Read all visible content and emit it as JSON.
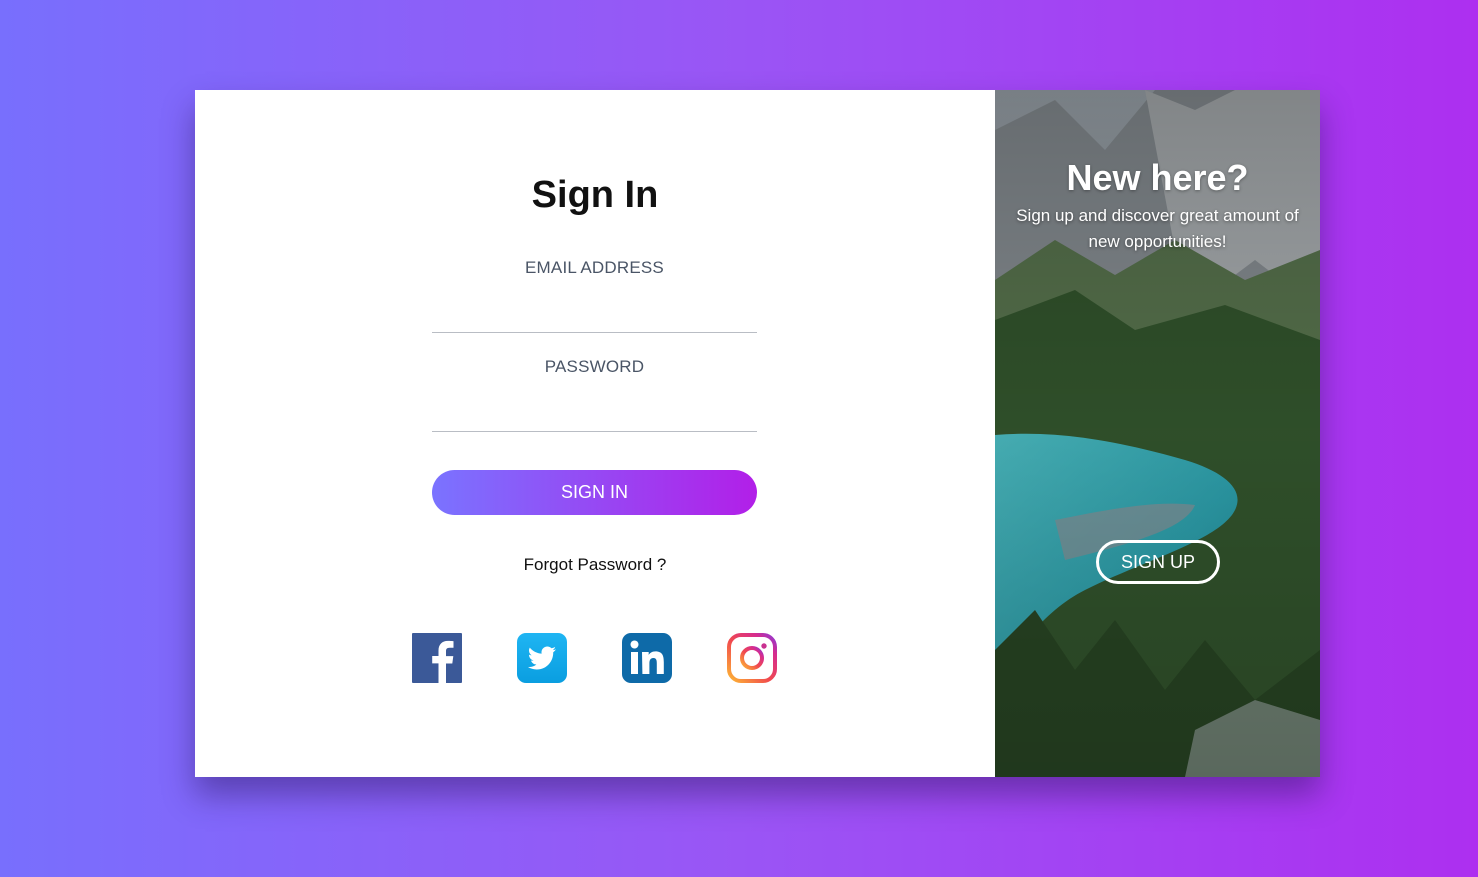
{
  "signin": {
    "title": "Sign In",
    "email_label": "EMAIL ADDRESS",
    "email_value": "",
    "password_label": "PASSWORD",
    "password_value": "",
    "button_label": "SIGN IN",
    "forgot_label": "Forgot Password ?",
    "social": [
      {
        "icon": "facebook-icon",
        "color": "#3b5998"
      },
      {
        "icon": "twitter-icon",
        "color": "#1da1f2"
      },
      {
        "icon": "linkedin-icon",
        "color": "#0e76a8"
      },
      {
        "icon": "instagram-icon",
        "color": "#e1306c"
      }
    ]
  },
  "promo": {
    "title": "New here?",
    "subtitle": "Sign up and discover great amount of new opportunities!",
    "button_label": "SIGN UP"
  },
  "colors": {
    "background_start": "#786ffd",
    "background_end": "#ad2ff0",
    "button_gradient_start": "#7a73ff",
    "button_gradient_end": "#b21fe8"
  }
}
